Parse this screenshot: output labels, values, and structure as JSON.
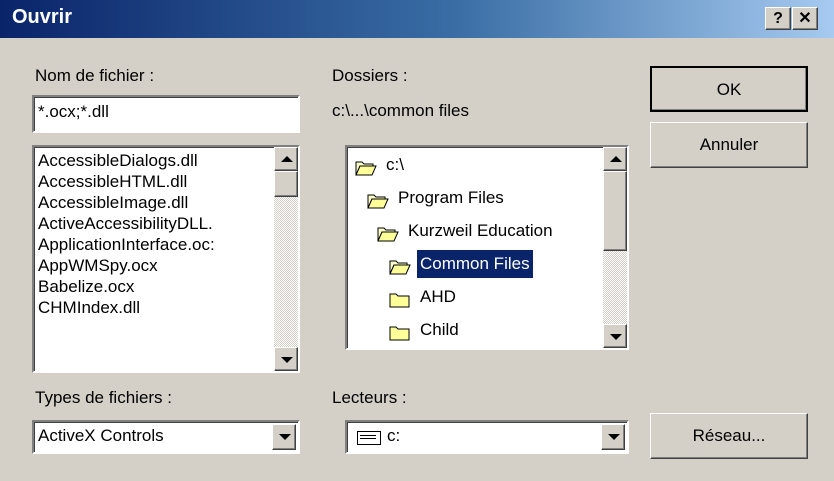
{
  "window": {
    "title": "Ouvrir",
    "help_label": "?",
    "close_label": "✕"
  },
  "file_name": {
    "label": "Nom de fichier :",
    "value": "*.ocx;*.dll",
    "files": [
      "AccessibleDialogs.dll",
      "AccessibleHTML.dll",
      "AccessibleImage.dll",
      "ActiveAccessibilityDLL.",
      "ApplicationInterface.oc:",
      "AppWMSpy.ocx",
      "Babelize.ocx",
      "CHMIndex.dll"
    ]
  },
  "folders": {
    "label": "Dossiers :",
    "current_path": "c:\\...\\common files",
    "items": [
      {
        "label": "c:\\",
        "icon": "open-folder-icon",
        "selected": false
      },
      {
        "label": "Program Files",
        "icon": "open-folder-icon",
        "selected": false
      },
      {
        "label": "Kurzweil Education",
        "icon": "open-folder-icon",
        "selected": false
      },
      {
        "label": "Common Files",
        "icon": "open-folder-icon",
        "selected": true
      },
      {
        "label": "AHD",
        "icon": "closed-folder-icon",
        "selected": false
      },
      {
        "label": "Child",
        "icon": "closed-folder-icon",
        "selected": false
      }
    ]
  },
  "file_types": {
    "label": "Types de fichiers :",
    "value": "ActiveX Controls"
  },
  "drives": {
    "label": "Lecteurs :",
    "value": "c:",
    "icon": "drive-icon"
  },
  "buttons": {
    "ok": "OK",
    "cancel": "Annuler",
    "network": "Réseau..."
  },
  "colors": {
    "titlebar_start": "#0a246a",
    "titlebar_end": "#a6caf0",
    "selection": "#0a246a",
    "dialog_bg": "#d4d0c8"
  }
}
